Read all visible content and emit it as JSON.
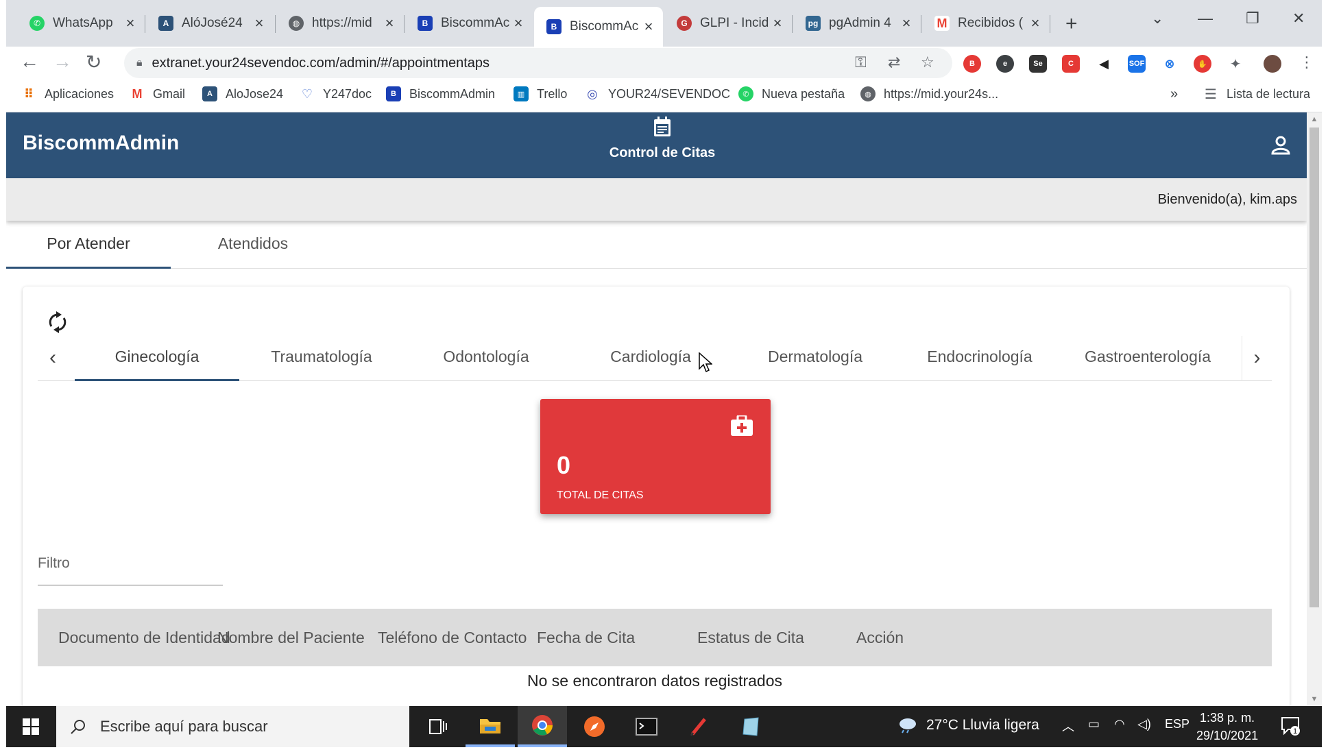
{
  "browser": {
    "tabs": [
      {
        "title": "WhatsApp",
        "icon": "whatsapp-icon",
        "color": "#25d366"
      },
      {
        "title": "AlóJosé24",
        "icon": "alojose-icon",
        "color": "#2d5278"
      },
      {
        "title": "https://mid",
        "icon": "globe-icon",
        "color": "#5f6368"
      },
      {
        "title": "BiscommAc",
        "icon": "biscomm-icon",
        "color": "#1a3fb5"
      },
      {
        "title": "BiscommAc",
        "icon": "biscomm-icon",
        "color": "#1a3fb5",
        "active": true
      },
      {
        "title": "GLPI - Incid",
        "icon": "glpi-icon",
        "color": "#c33b3b"
      },
      {
        "title": "pgAdmin 4",
        "icon": "pgadmin-icon",
        "color": "#336791"
      },
      {
        "title": "Recibidos (",
        "icon": "gmail-icon",
        "color": "#ea4335"
      }
    ],
    "new_tab_symbol": "+",
    "url": "extranet.your24sevendoc.com/admin/#/appointmentaps",
    "extensions": [
      "B",
      "e",
      "Se",
      "C",
      "◀",
      "SOF",
      "⊗",
      "✋",
      "✦"
    ],
    "bookmarks": [
      {
        "label": "Aplicaciones",
        "icon": "apps-grid-icon"
      },
      {
        "label": "Gmail",
        "icon": "gmail-icon"
      },
      {
        "label": "AloJose24",
        "icon": "alojose-icon"
      },
      {
        "label": "Y247doc",
        "icon": "y247doc-icon"
      },
      {
        "label": "BiscommAdmin",
        "icon": "biscomm-icon"
      },
      {
        "label": "Trello",
        "icon": "trello-icon"
      },
      {
        "label": "YOUR24/SEVENDOC",
        "icon": "your24-icon"
      },
      {
        "label": "Nueva pestaña",
        "icon": "whatsapp-icon"
      },
      {
        "label": "https://mid.your24s...",
        "icon": "globe-icon"
      }
    ],
    "bookmarks_overflow": "»",
    "reading_list": "Lista de lectura"
  },
  "app": {
    "brand": "BiscommAdmin",
    "section_title": "Control de Citas",
    "welcome": "Bienvenido(a), kim.aps",
    "primary_color": "#2d5278",
    "main_tabs": [
      {
        "label": "Por Atender",
        "active": true
      },
      {
        "label": "Atendidos",
        "active": false
      }
    ],
    "specialty_tabs": [
      {
        "label": "Ginecología",
        "active": true
      },
      {
        "label": "Traumatología"
      },
      {
        "label": "Odontología"
      },
      {
        "label": "Cardiología"
      },
      {
        "label": "Dermatología"
      },
      {
        "label": "Endocrinología"
      },
      {
        "label": "Gastroenterología"
      }
    ],
    "stat": {
      "value": "0",
      "label": "TOTAL DE CITAS",
      "color": "#e0393b"
    },
    "filter_placeholder": "Filtro",
    "table": {
      "headers": [
        "Documento de Identidad",
        "Nombre del Paciente",
        "Teléfono de Contacto",
        "Fecha de Cita",
        "Estatus de Cita",
        "Acción"
      ],
      "empty_message": "No se encontraron datos registrados"
    }
  },
  "taskbar": {
    "search_placeholder": "Escribe aquí para buscar",
    "weather": "27°C  Lluvia ligera",
    "language": "ESP",
    "time": "1:38 p. m.",
    "date": "29/10/2021",
    "notifications": "1"
  }
}
